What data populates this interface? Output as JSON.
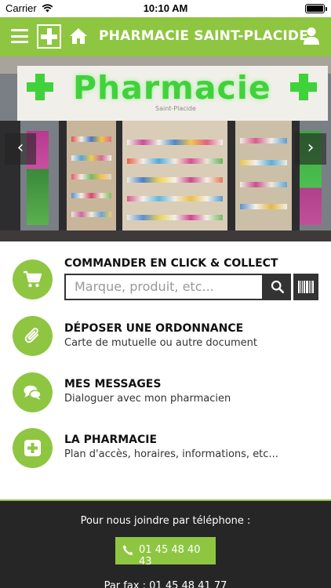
{
  "status_bar": {
    "carrier": "Carrier",
    "time": "10:10 AM"
  },
  "header": {
    "title": "PHARMACIE SAINT-PLACIDE",
    "color": "#8ec641"
  },
  "hero": {
    "sign_text": "Pharmacie",
    "sign_subtext": "Saint-Placide",
    "prev_label": "‹",
    "next_label": "›"
  },
  "click_collect": {
    "title": "COMMANDER EN CLICK & COLLECT",
    "search_placeholder": "Marque, produit, etc..."
  },
  "ordonnance": {
    "title": "DÉPOSER UNE ORDONNANCE",
    "subtitle": "Carte de mutuelle ou autre document"
  },
  "messages": {
    "title": "MES MESSAGES",
    "subtitle": "Dialoguer avec mon pharmacien"
  },
  "pharmacie": {
    "title": "LA PHARMACIE",
    "subtitle": "Plan d'accès, horaires, informations, etc..."
  },
  "footer": {
    "phone_label": "Pour nous joindre par téléphone :",
    "phone_number": "01 45 48 40 43",
    "fax": "Par fax : 01 45 48 41 77"
  },
  "icons": {
    "menu": "hamburger-menu-icon",
    "logo": "pharmacy-cross-icon",
    "home": "home-icon",
    "user": "user-icon",
    "cart": "cart-icon",
    "search": "search-icon",
    "barcode": "barcode-icon",
    "attachment": "paperclip-icon",
    "chat": "chat-icon",
    "plus": "plus-square-icon",
    "phone": "phone-icon"
  }
}
